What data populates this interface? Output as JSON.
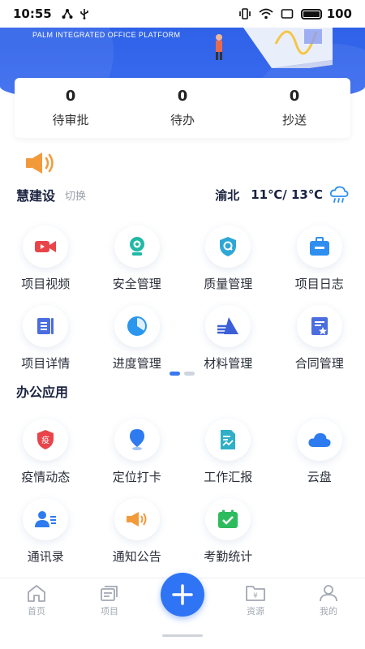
{
  "status_bar": {
    "time": "10:55",
    "battery": "100"
  },
  "header": {
    "platform": "PALM INTEGRATED OFFICE PLATFORM"
  },
  "summary": [
    {
      "count": "0",
      "label": "待审批"
    },
    {
      "count": "0",
      "label": "待办"
    },
    {
      "count": "0",
      "label": "抄送"
    }
  ],
  "site": {
    "title": "慧建设",
    "switch_label": "切换"
  },
  "weather": {
    "city": "渝北",
    "temperature": "11℃/ 13℃",
    "icon": "rain-cloud-icon"
  },
  "construction_apps": [
    {
      "label": "项目视频",
      "icon": "video-camera-icon",
      "color": "#e8444a"
    },
    {
      "label": "安全管理",
      "icon": "webcam-icon",
      "color": "#22b8a6"
    },
    {
      "label": "质量管理",
      "icon": "shield-q-icon",
      "color": "#2fa7d6"
    },
    {
      "label": "项目日志",
      "icon": "briefcase-icon",
      "color": "#2e8ff0"
    },
    {
      "label": "项目详情",
      "icon": "document-list-icon",
      "color": "#4b6de0"
    },
    {
      "label": "进度管理",
      "icon": "pie-progress-icon",
      "color": "#2a96ee"
    },
    {
      "label": "材料管理",
      "icon": "materials-icon",
      "color": "#3c5fd8"
    },
    {
      "label": "合同管理",
      "icon": "contract-icon",
      "color": "#4b6de0"
    }
  ],
  "pager": {
    "total": 2,
    "active": 0
  },
  "office_section": {
    "title": "办公应用"
  },
  "office_apps": [
    {
      "label": "疫情动态",
      "icon": "epidemic-shield-icon",
      "color": "#e8444a",
      "glyph": "疫"
    },
    {
      "label": "定位打卡",
      "icon": "location-pin-icon",
      "color": "#2e7bf0"
    },
    {
      "label": "工作汇报",
      "icon": "report-icon",
      "color": "#2fb0c6"
    },
    {
      "label": "云盘",
      "icon": "cloud-icon",
      "color": "#2e7bf0"
    },
    {
      "label": "通讯录",
      "icon": "contacts-icon",
      "color": "#2e7bf0"
    },
    {
      "label": "通知公告",
      "icon": "megaphone-icon",
      "color": "#f29a3a"
    },
    {
      "label": "考勤统计",
      "icon": "attendance-check-icon",
      "color": "#2dbb5e"
    }
  ],
  "bottom_nav": [
    {
      "label": "首页",
      "icon": "home-icon"
    },
    {
      "label": "项目",
      "icon": "project-icon"
    },
    {
      "label": "资源",
      "icon": "resource-folder-icon",
      "glyph": "¥"
    },
    {
      "label": "我的",
      "icon": "user-icon"
    }
  ],
  "colors": {
    "primary": "#2f62e8",
    "accent": "#2f74f5",
    "speaker": "#f29a3a"
  }
}
